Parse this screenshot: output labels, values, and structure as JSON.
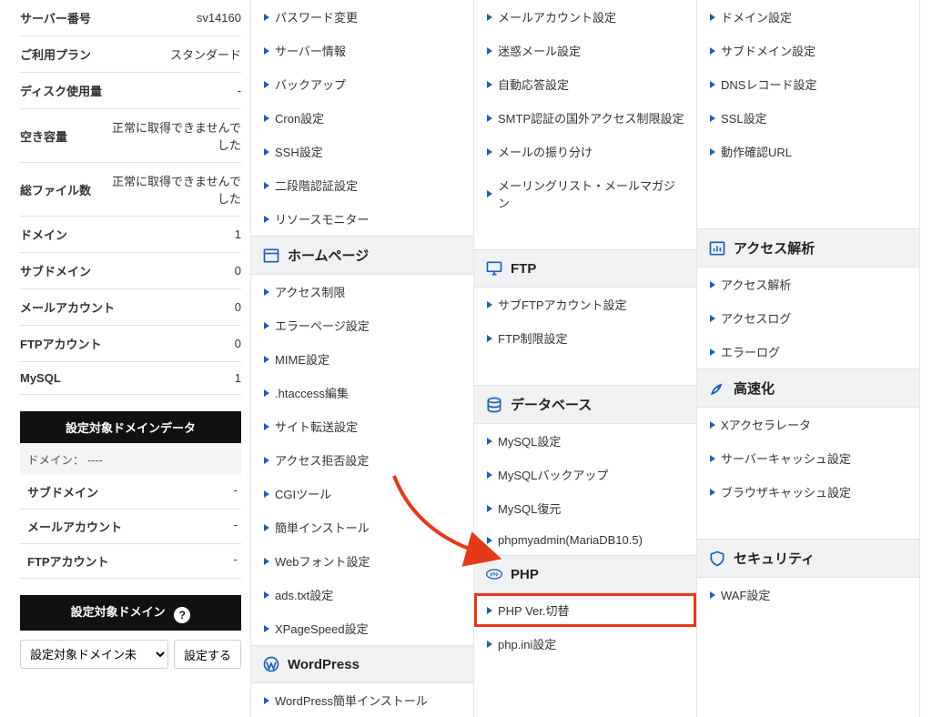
{
  "sidebar": {
    "stats": [
      {
        "label": "サーバー番号",
        "value": "sv14160"
      },
      {
        "label": "ご利用プラン",
        "value": "スタンダード"
      },
      {
        "label": "ディスク使用量",
        "value": "-"
      },
      {
        "label": "空き容量",
        "value": "正常に取得できませんでした"
      },
      {
        "label": "総ファイル数",
        "value": "正常に取得できませんでした"
      },
      {
        "label": "ドメイン",
        "value": "1"
      },
      {
        "label": "サブドメイン",
        "value": "0"
      },
      {
        "label": "メールアカウント",
        "value": "0"
      },
      {
        "label": "FTPアカウント",
        "value": "0"
      },
      {
        "label": "MySQL",
        "value": "1"
      }
    ],
    "domain_data_header": "設定対象ドメインデータ",
    "domain_line": "ドメイン： ----",
    "domain_rows": [
      {
        "label": "サブドメイン",
        "value": "-"
      },
      {
        "label": "メールアカウント",
        "value": "-"
      },
      {
        "label": "FTPアカウント",
        "value": "-"
      }
    ],
    "target_domain_header": "設定対象ドメイン",
    "select_value": "設定対象ドメイン未",
    "set_button": "設定する"
  },
  "cats": {
    "account": {
      "title": "",
      "items": [
        "パスワード変更",
        "サーバー情報",
        "バックアップ",
        "Cron設定",
        "SSH設定",
        "二段階認証設定",
        "リソースモニター"
      ]
    },
    "mail": {
      "title": "",
      "items": [
        "メールアカウント設定",
        "迷惑メール設定",
        "自動応答設定",
        "SMTP認証の国外アクセス制限設定",
        "メールの振り分け",
        "メーリングリスト・メールマガジン"
      ]
    },
    "domain": {
      "title": "",
      "items": [
        "ドメイン設定",
        "サブドメイン設定",
        "DNSレコード設定",
        "SSL設定",
        "動作確認URL"
      ]
    },
    "homepage": {
      "title": "ホームページ",
      "items": [
        "アクセス制限",
        "エラーページ設定",
        "MIME設定",
        ".htaccess編集",
        "サイト転送設定",
        "アクセス拒否設定",
        "CGIツール",
        "簡単インストール",
        "Webフォント設定",
        "ads.txt設定",
        "XPageSpeed設定"
      ]
    },
    "wordpress": {
      "title": "WordPress",
      "items": [
        "WordPress簡単インストール"
      ]
    },
    "ftp": {
      "title": "FTP",
      "items": [
        "サブFTPアカウント設定",
        "FTP制限設定"
      ]
    },
    "database": {
      "title": "データベース",
      "items": [
        "MySQL設定",
        "MySQLバックアップ",
        "MySQL復元",
        "phpmyadmin(MariaDB10.5)"
      ]
    },
    "php": {
      "title": "PHP",
      "items": [
        "PHP Ver.切替",
        "php.ini設定"
      ]
    },
    "access": {
      "title": "アクセス解析",
      "items": [
        "アクセス解析",
        "アクセスログ",
        "エラーログ"
      ]
    },
    "speed": {
      "title": "高速化",
      "items": [
        "Xアクセラレータ",
        "サーバーキャッシュ設定",
        "ブラウザキャッシュ設定"
      ]
    },
    "security": {
      "title": "セキュリティ",
      "items": [
        "WAF設定"
      ]
    }
  }
}
